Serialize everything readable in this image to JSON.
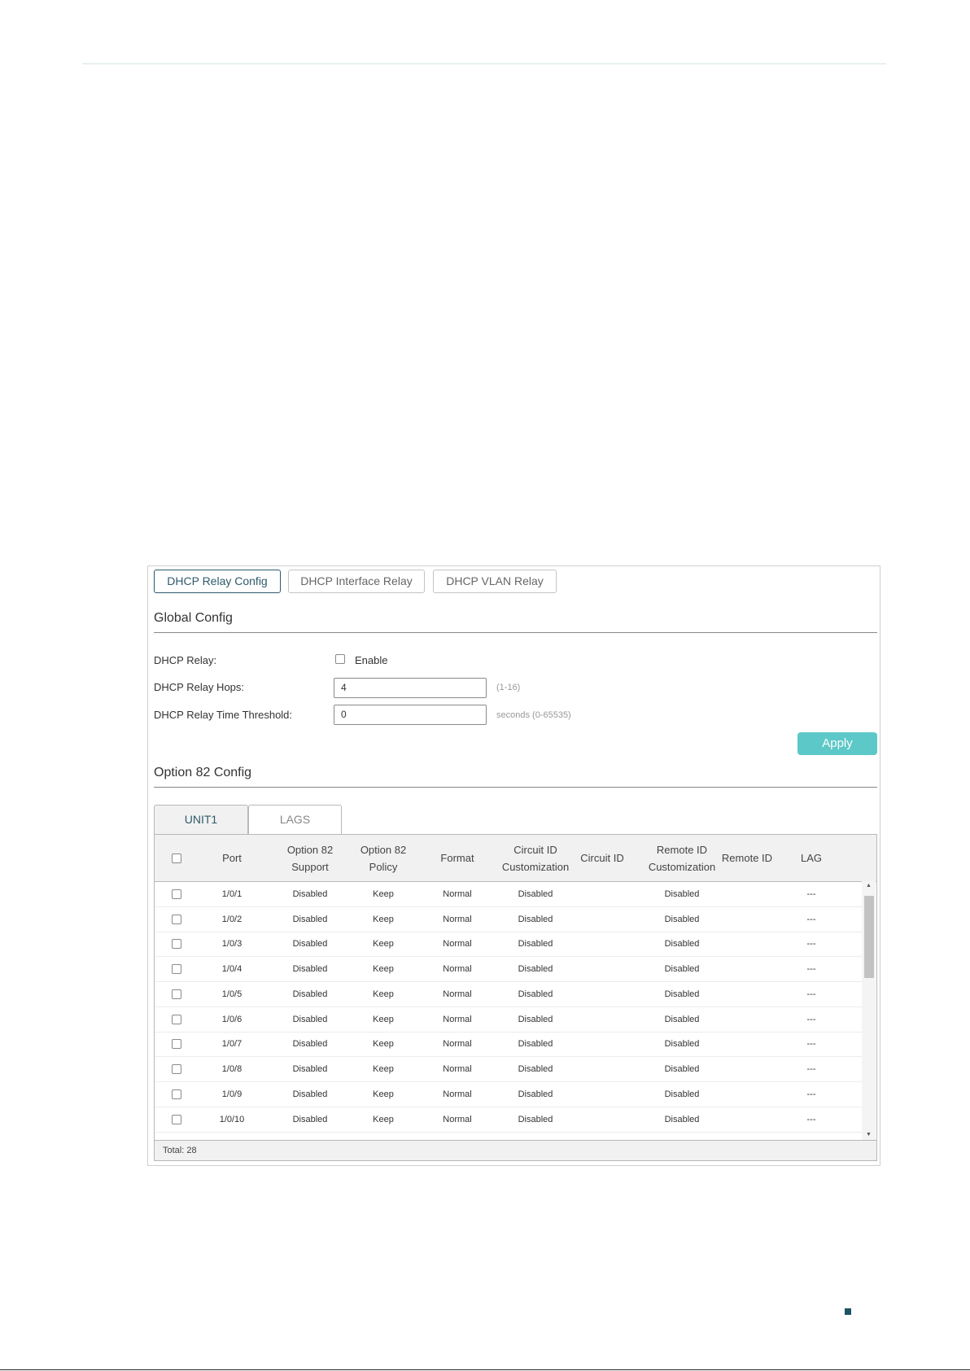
{
  "top_tabs": [
    {
      "label": "DHCP Relay Config",
      "active": true
    },
    {
      "label": "DHCP Interface Relay",
      "active": false
    },
    {
      "label": "DHCP VLAN Relay",
      "active": false
    }
  ],
  "global_config": {
    "title": "Global Config",
    "dhcp_relay_label": "DHCP Relay:",
    "enable_label": "Enable",
    "enable_checked": false,
    "hops_label": "DHCP Relay Hops:",
    "hops_value": "4",
    "hops_hint": "(1-16)",
    "threshold_label": "DHCP Relay Time Threshold:",
    "threshold_value": "0",
    "threshold_hint": "seconds (0-65535)",
    "apply_label": "Apply"
  },
  "option82": {
    "title": "Option 82 Config",
    "unit_tabs": [
      {
        "label": "UNIT1",
        "active": true
      },
      {
        "label": "LAGS",
        "active": false
      }
    ],
    "columns": [
      {
        "line1": "Port",
        "line2": ""
      },
      {
        "line1": "Option 82",
        "line2": "Support"
      },
      {
        "line1": "Option 82",
        "line2": "Policy"
      },
      {
        "line1": "Format",
        "line2": ""
      },
      {
        "line1": "Circuit ID",
        "line2": "Customization"
      },
      {
        "line1": "Circuit ID",
        "line2": ""
      },
      {
        "line1": "Remote ID",
        "line2": "Customization"
      },
      {
        "line1": "Remote ID",
        "line2": ""
      },
      {
        "line1": "LAG",
        "line2": ""
      }
    ],
    "rows": [
      {
        "port": "1/0/1",
        "support": "Disabled",
        "policy": "Keep",
        "format": "Normal",
        "circuit_cust": "Disabled",
        "circuit_id": "",
        "remote_cust": "Disabled",
        "remote_id": "",
        "lag": "---"
      },
      {
        "port": "1/0/2",
        "support": "Disabled",
        "policy": "Keep",
        "format": "Normal",
        "circuit_cust": "Disabled",
        "circuit_id": "",
        "remote_cust": "Disabled",
        "remote_id": "",
        "lag": "---"
      },
      {
        "port": "1/0/3",
        "support": "Disabled",
        "policy": "Keep",
        "format": "Normal",
        "circuit_cust": "Disabled",
        "circuit_id": "",
        "remote_cust": "Disabled",
        "remote_id": "",
        "lag": "---"
      },
      {
        "port": "1/0/4",
        "support": "Disabled",
        "policy": "Keep",
        "format": "Normal",
        "circuit_cust": "Disabled",
        "circuit_id": "",
        "remote_cust": "Disabled",
        "remote_id": "",
        "lag": "---"
      },
      {
        "port": "1/0/5",
        "support": "Disabled",
        "policy": "Keep",
        "format": "Normal",
        "circuit_cust": "Disabled",
        "circuit_id": "",
        "remote_cust": "Disabled",
        "remote_id": "",
        "lag": "---"
      },
      {
        "port": "1/0/6",
        "support": "Disabled",
        "policy": "Keep",
        "format": "Normal",
        "circuit_cust": "Disabled",
        "circuit_id": "",
        "remote_cust": "Disabled",
        "remote_id": "",
        "lag": "---"
      },
      {
        "port": "1/0/7",
        "support": "Disabled",
        "policy": "Keep",
        "format": "Normal",
        "circuit_cust": "Disabled",
        "circuit_id": "",
        "remote_cust": "Disabled",
        "remote_id": "",
        "lag": "---"
      },
      {
        "port": "1/0/8",
        "support": "Disabled",
        "policy": "Keep",
        "format": "Normal",
        "circuit_cust": "Disabled",
        "circuit_id": "",
        "remote_cust": "Disabled",
        "remote_id": "",
        "lag": "---"
      },
      {
        "port": "1/0/9",
        "support": "Disabled",
        "policy": "Keep",
        "format": "Normal",
        "circuit_cust": "Disabled",
        "circuit_id": "",
        "remote_cust": "Disabled",
        "remote_id": "",
        "lag": "---"
      },
      {
        "port": "1/0/10",
        "support": "Disabled",
        "policy": "Keep",
        "format": "Normal",
        "circuit_cust": "Disabled",
        "circuit_id": "",
        "remote_cust": "Disabled",
        "remote_id": "",
        "lag": "---"
      }
    ],
    "footer": "Total: 28"
  },
  "colors": {
    "accent": "#2d5a6b",
    "apply_button": "#5cc8c8",
    "page_marker": "#1d5266"
  }
}
